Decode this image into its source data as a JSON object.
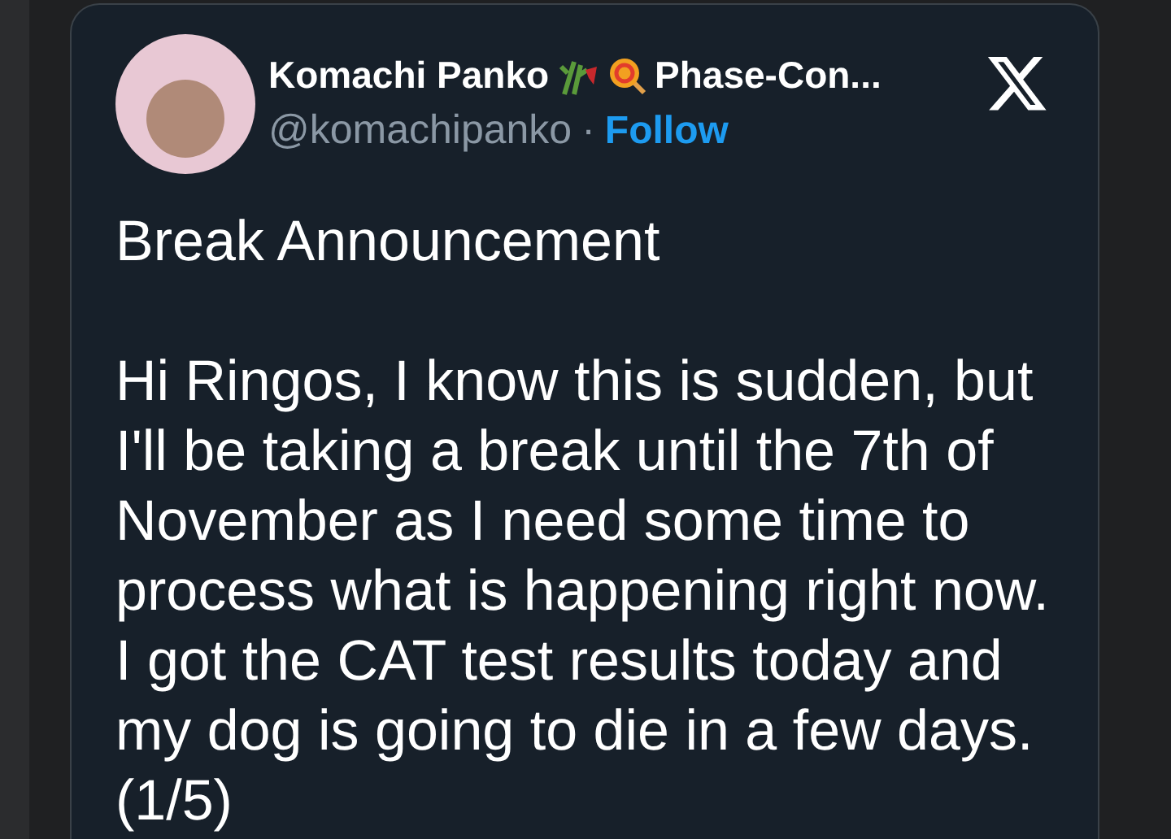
{
  "post": {
    "author": {
      "name": "Komachi Panko",
      "name_rest": "Phase-Con...",
      "handle": "@komachipanko",
      "separator": "·",
      "follow": "Follow"
    },
    "title": "Break Announcement",
    "body": "Hi Ringos, I know this is sudden, but\nI'll be taking a break until the 7th of\nNovember as I need some time to\nprocess what is happening right now.\nI got the CAT test results today and\nmy dog is going to die in a few days.\n(1/5)"
  }
}
